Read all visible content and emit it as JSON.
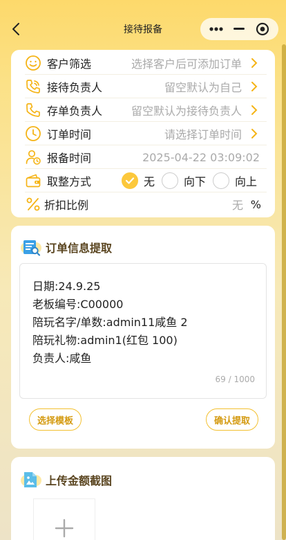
{
  "nav": {
    "title": "接待报备"
  },
  "form": {
    "rows": [
      {
        "label": "客户筛选",
        "value": "选择客户后可添加订单"
      },
      {
        "label": "接待负责人",
        "value": "留空默认为自己"
      },
      {
        "label": "存单负责人",
        "value": "留空默认为接待负责人"
      },
      {
        "label": "订单时间",
        "value": "请选择订单时间"
      },
      {
        "label": "报备时间",
        "value": "2025-04-22 03:09:02"
      }
    ],
    "rounding": {
      "label": "取整方式",
      "options": [
        "无",
        "向下",
        "向上"
      ],
      "selected": "无"
    },
    "discount": {
      "label": "折扣比例",
      "placeholder": "无",
      "unit": "%"
    }
  },
  "extract": {
    "title": "订单信息提取",
    "lines": [
      "日期:24.9.25",
      "老板编号:C00000",
      "陪玩名字/单数:admin11咸鱼 2",
      "陪玩礼物:admin1(红包 100)",
      "负责人:咸鱼"
    ],
    "counter": "69 / 1000",
    "template_btn": "选择模板",
    "confirm_btn": "确认提取"
  },
  "upload": {
    "title": "上传金额截图"
  },
  "colors": {
    "accent": "#fcc83c",
    "accent_text": "#d49a10",
    "icon_orange": "#f5b417"
  }
}
